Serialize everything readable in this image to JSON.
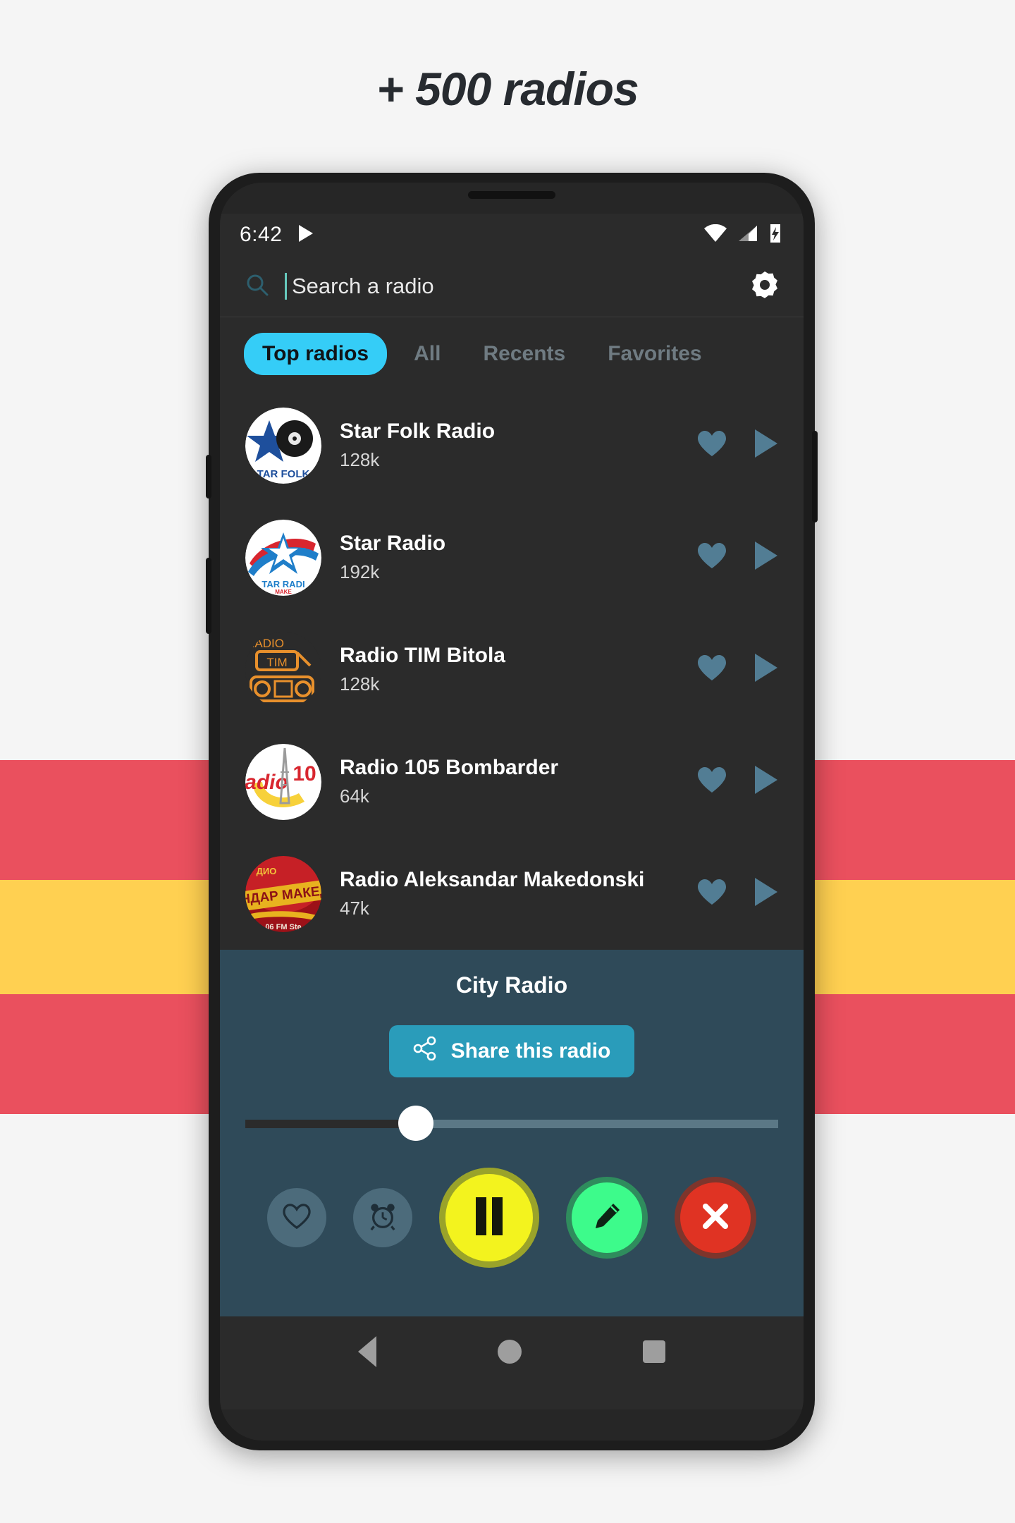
{
  "promo": {
    "headline": "+ 500 radios",
    "stripe_colors": [
      "#ea505e",
      "#ffd051",
      "#ea505e"
    ],
    "page_background": "#f5f5f5"
  },
  "statusbar": {
    "time": "6:42",
    "play_icon": "play-icon",
    "wifi_icon": "wifi-icon",
    "signal_icon": "cellular-signal-icon",
    "battery_icon": "battery-charging-icon"
  },
  "search": {
    "icon": "search-icon",
    "placeholder": "Search a radio",
    "value": "",
    "settings_icon": "gear-icon",
    "cursor_color": "#66c9bd",
    "icon_color": "#2d5f6e"
  },
  "tabs": {
    "active_index": 0,
    "active_color": "#35cdf7",
    "inactive_color": "#6f7b82",
    "items": [
      {
        "label": "Top radios"
      },
      {
        "label": "All"
      },
      {
        "label": "Recents"
      },
      {
        "label": "Favorites"
      }
    ]
  },
  "list": {
    "favorite_icon": "heart-icon",
    "play_icon": "play-icon",
    "action_color": "#527d94",
    "items": [
      {
        "title": "Star Folk Radio",
        "bitrate": "128k",
        "logo": "star-folk-radio-logo"
      },
      {
        "title": "Star Radio",
        "bitrate": "192k",
        "logo": "star-radio-logo"
      },
      {
        "title": "Radio TIM Bitola",
        "bitrate": "128k",
        "logo": "radio-tim-bitola-logo"
      },
      {
        "title": "Radio 105 Bombarder",
        "bitrate": "64k",
        "logo": "radio-105-bombarder-logo"
      },
      {
        "title": "Radio Aleksandar Makedonski",
        "bitrate": "47k",
        "logo": "radio-aleksandar-makedonski-logo"
      }
    ]
  },
  "player": {
    "background": "#2f4a59",
    "now_playing": "City Radio",
    "share_label": "Share this radio",
    "share_icon": "share-icon",
    "share_button_color": "#2a9cba",
    "volume_percent": 32,
    "controls": [
      {
        "name": "favorite-button",
        "icon": "heart-outline-icon",
        "color": "#4c6b7b"
      },
      {
        "name": "sleep-timer-button",
        "icon": "alarm-clock-icon",
        "color": "#4c6b7b"
      },
      {
        "name": "pause-button",
        "icon": "pause-icon",
        "color": "#f3f31e"
      },
      {
        "name": "edit-button",
        "icon": "pencil-icon",
        "color": "#3dfb8b"
      },
      {
        "name": "close-button",
        "icon": "close-x-icon",
        "color": "#e03323"
      }
    ]
  },
  "navbar": {
    "back": "back-triangle-icon",
    "home": "home-circle-icon",
    "recents": "recents-square-icon"
  }
}
